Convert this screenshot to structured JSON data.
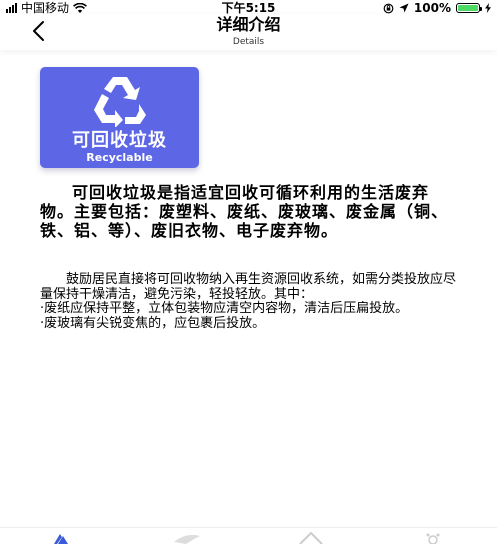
{
  "status_bar": {
    "carrier": "中国移动",
    "time": "下午5:15",
    "battery": "100%"
  },
  "header": {
    "title": "详细介绍",
    "subtitle": "Details"
  },
  "card": {
    "title": "可回收垃圾",
    "subtitle": "Recyclable",
    "color": "#5d67e5",
    "icon": "recycle-icon"
  },
  "intro": "可回收垃圾是指适宜回收可循环利用的生活废弃物。主要包括：废塑料、废纸、废玻璃、废金属（铜、铁、铝、等）、废旧衣物、电子废弃物。",
  "detail": {
    "paragraph": "鼓励居民直接将可回收物纳入再生资源回收系统，如需分类投放应尽量保持干燥清洁，避免污染，轻投轻放。其中：",
    "bullet_1": "·废纸应保持平整，立体包装物应清空内容物，清洁后压扁投放。",
    "bullet_2": "·废玻璃有尖锐变焦的，应包裹后投放。"
  }
}
